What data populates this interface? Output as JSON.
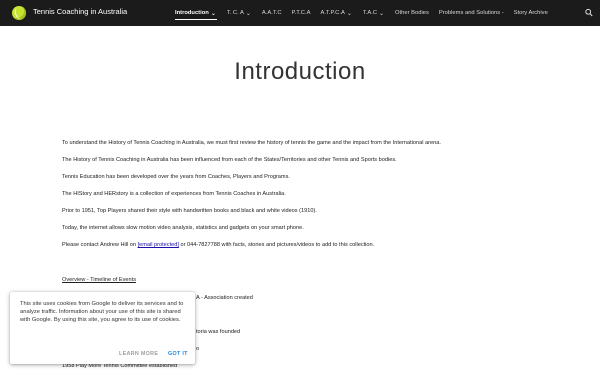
{
  "site": {
    "title": "Tennis Coaching in Australia"
  },
  "nav": {
    "items": [
      {
        "label": "Introduction",
        "has_dropdown": true,
        "active": true
      },
      {
        "label": "T. C. A",
        "has_dropdown": true
      },
      {
        "label": "A.A.T.C",
        "has_dropdown": false
      },
      {
        "label": "P.T.C.A",
        "has_dropdown": false
      },
      {
        "label": "A.T.P.C.A",
        "has_dropdown": true
      },
      {
        "label": "T.A.C",
        "has_dropdown": true
      },
      {
        "label": "Other Bodies",
        "has_dropdown": false
      },
      {
        "label": "Problems and Solutions -",
        "has_dropdown": false
      },
      {
        "label": "Story Archive",
        "has_dropdown": false
      }
    ],
    "search_icon": "search-icon"
  },
  "main": {
    "title": "Introduction",
    "paragraphs": [
      "To understand the History of Tennis Coaching in Australia, we must first review the history of tennis the game and the impact from the International arena.",
      "The History of Tennis Coaching in Australia has been influenced from each of the States/Territories and other Tennis and Sports bodies.",
      "Tennis Education has been developed over the years from Coaches, Players and Programs.",
      "The HIStory and HERstory is a collection of experiences from Tennis Coaches in Australia.",
      "Prior to 1951, Top Players shared their style with handwritten books and black and white videos (1910).",
      "Today, the internet allows slow motion video analysis, statistics and gadgets on your smart phone."
    ],
    "contact": {
      "before": "Please contact Andrew Hill on ",
      "link": "[email protected]",
      "after": " or 044-7827788 with facts, stories and pictures/videos to add to this collection."
    },
    "overview_link": "Overview - Timeline of Events",
    "timeline_visible": [
      "A - Association created",
      "toria was founded",
      "o",
      "1958 Play More Tennis Committee established"
    ]
  },
  "cookie_banner": {
    "text": "This site uses cookies from Google to deliver its services and to analyze traffic. Information about your use of this site is shared with Google. By using this site, you agree to its use of cookies.",
    "learn_more": "LEARN MORE",
    "got_it": "GOT IT"
  },
  "colors": {
    "navbar_bg": "#1b1b1b",
    "logo": "#c6e233",
    "accent": "#1e88e5",
    "link": "#1a0dab"
  }
}
